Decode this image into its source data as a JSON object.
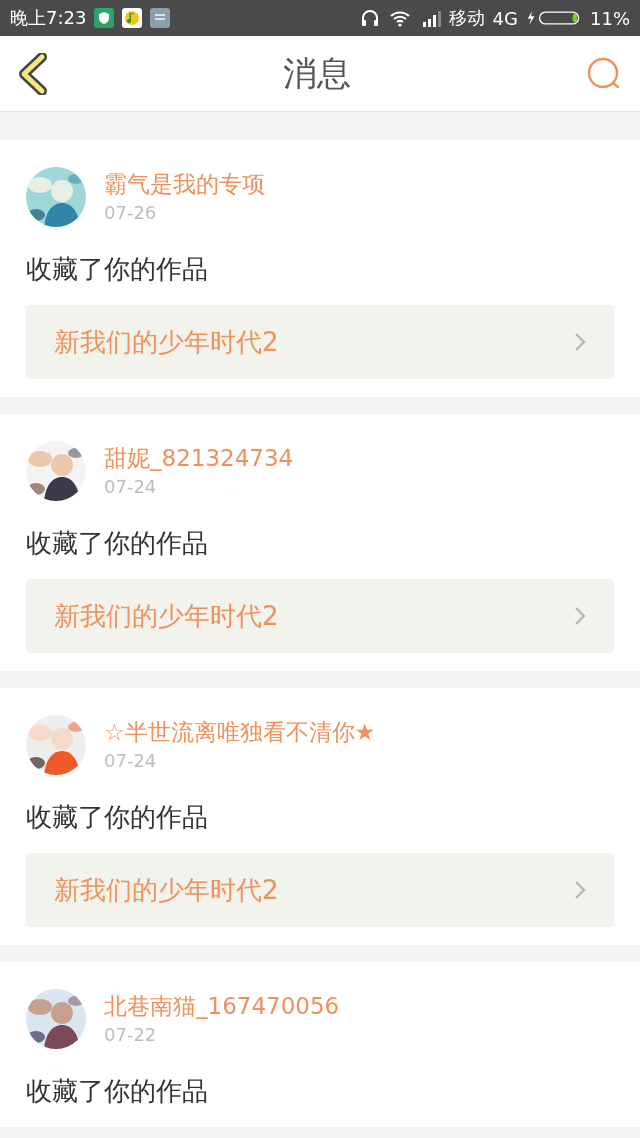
{
  "status_bar": {
    "time": "晚上7:23",
    "carrier": "移动",
    "network": "4G",
    "battery": "11%"
  },
  "header": {
    "title": "消息"
  },
  "messages": [
    {
      "user": "霸气是我的专项",
      "date": "07-26",
      "action": "收藏了你的作品",
      "work": "新我们的少年时代2"
    },
    {
      "user": "甜妮_821324734",
      "date": "07-24",
      "action": "收藏了你的作品",
      "work": "新我们的少年时代2"
    },
    {
      "user": "☆半世流离唯独看不清你★",
      "date": "07-24",
      "action": "收藏了你的作品",
      "work": "新我们的少年时代2"
    },
    {
      "user": "北巷南猫_167470056",
      "date": "07-22",
      "action": "收藏了你的作品"
    }
  ]
}
